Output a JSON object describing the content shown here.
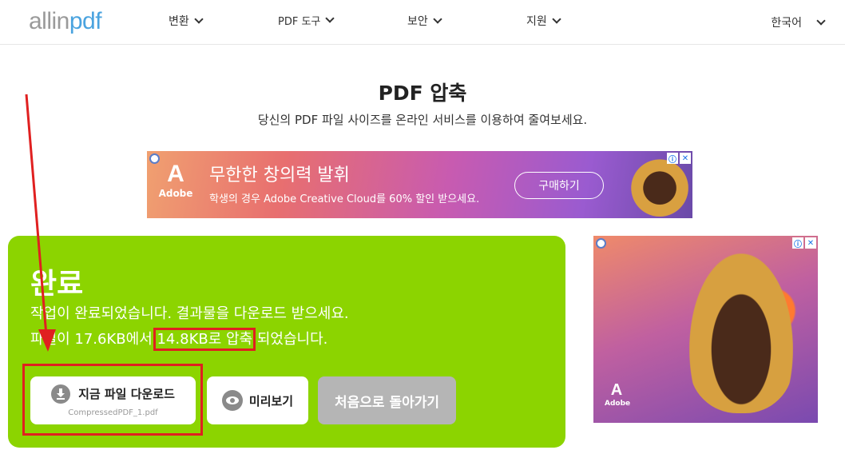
{
  "header": {
    "logo": {
      "part1": "allin",
      "part2": "pdf"
    },
    "nav": [
      {
        "label": "변환"
      },
      {
        "label": "PDF 도구"
      },
      {
        "label": "보안"
      },
      {
        "label": "지원"
      }
    ],
    "language": "한국어"
  },
  "page": {
    "title": "PDF 압축",
    "subtitle": "당신의 PDF 파일 사이즈를 온라인 서비스를 이용하여 줄여보세요."
  },
  "ad_top": {
    "brand_letter": "A",
    "brand_name": "Adobe",
    "headline": "무한한 창의력 발휘",
    "subtext": "학생의 경우 Adobe Creative Cloud를 60% 할인 받으세요.",
    "cta": "구매하기",
    "info_icon": "ⓘ",
    "close_icon": "✕"
  },
  "result": {
    "heading": "완료",
    "message": "작업이 완료되었습니다. 결과물을 다운로드 받으세요.",
    "size_prefix": "파일이 17.6KB에서 ",
    "size_highlight": "14.8KB로 압축",
    "size_suffix": " 되었습니다.",
    "download_label": "지금 파일 다운로드",
    "file_name": "CompressedPDF_1.pdf",
    "preview_label": "미리보기",
    "restart_label": "처음으로 돌아가기"
  },
  "ad_side": {
    "brand_letter": "A",
    "brand_name": "Adobe",
    "info_icon": "ⓘ",
    "close_icon": "✕"
  },
  "colors": {
    "panel_green": "#8cd400",
    "annotation_red": "#e02020",
    "logo_blue": "#4aa3df"
  }
}
